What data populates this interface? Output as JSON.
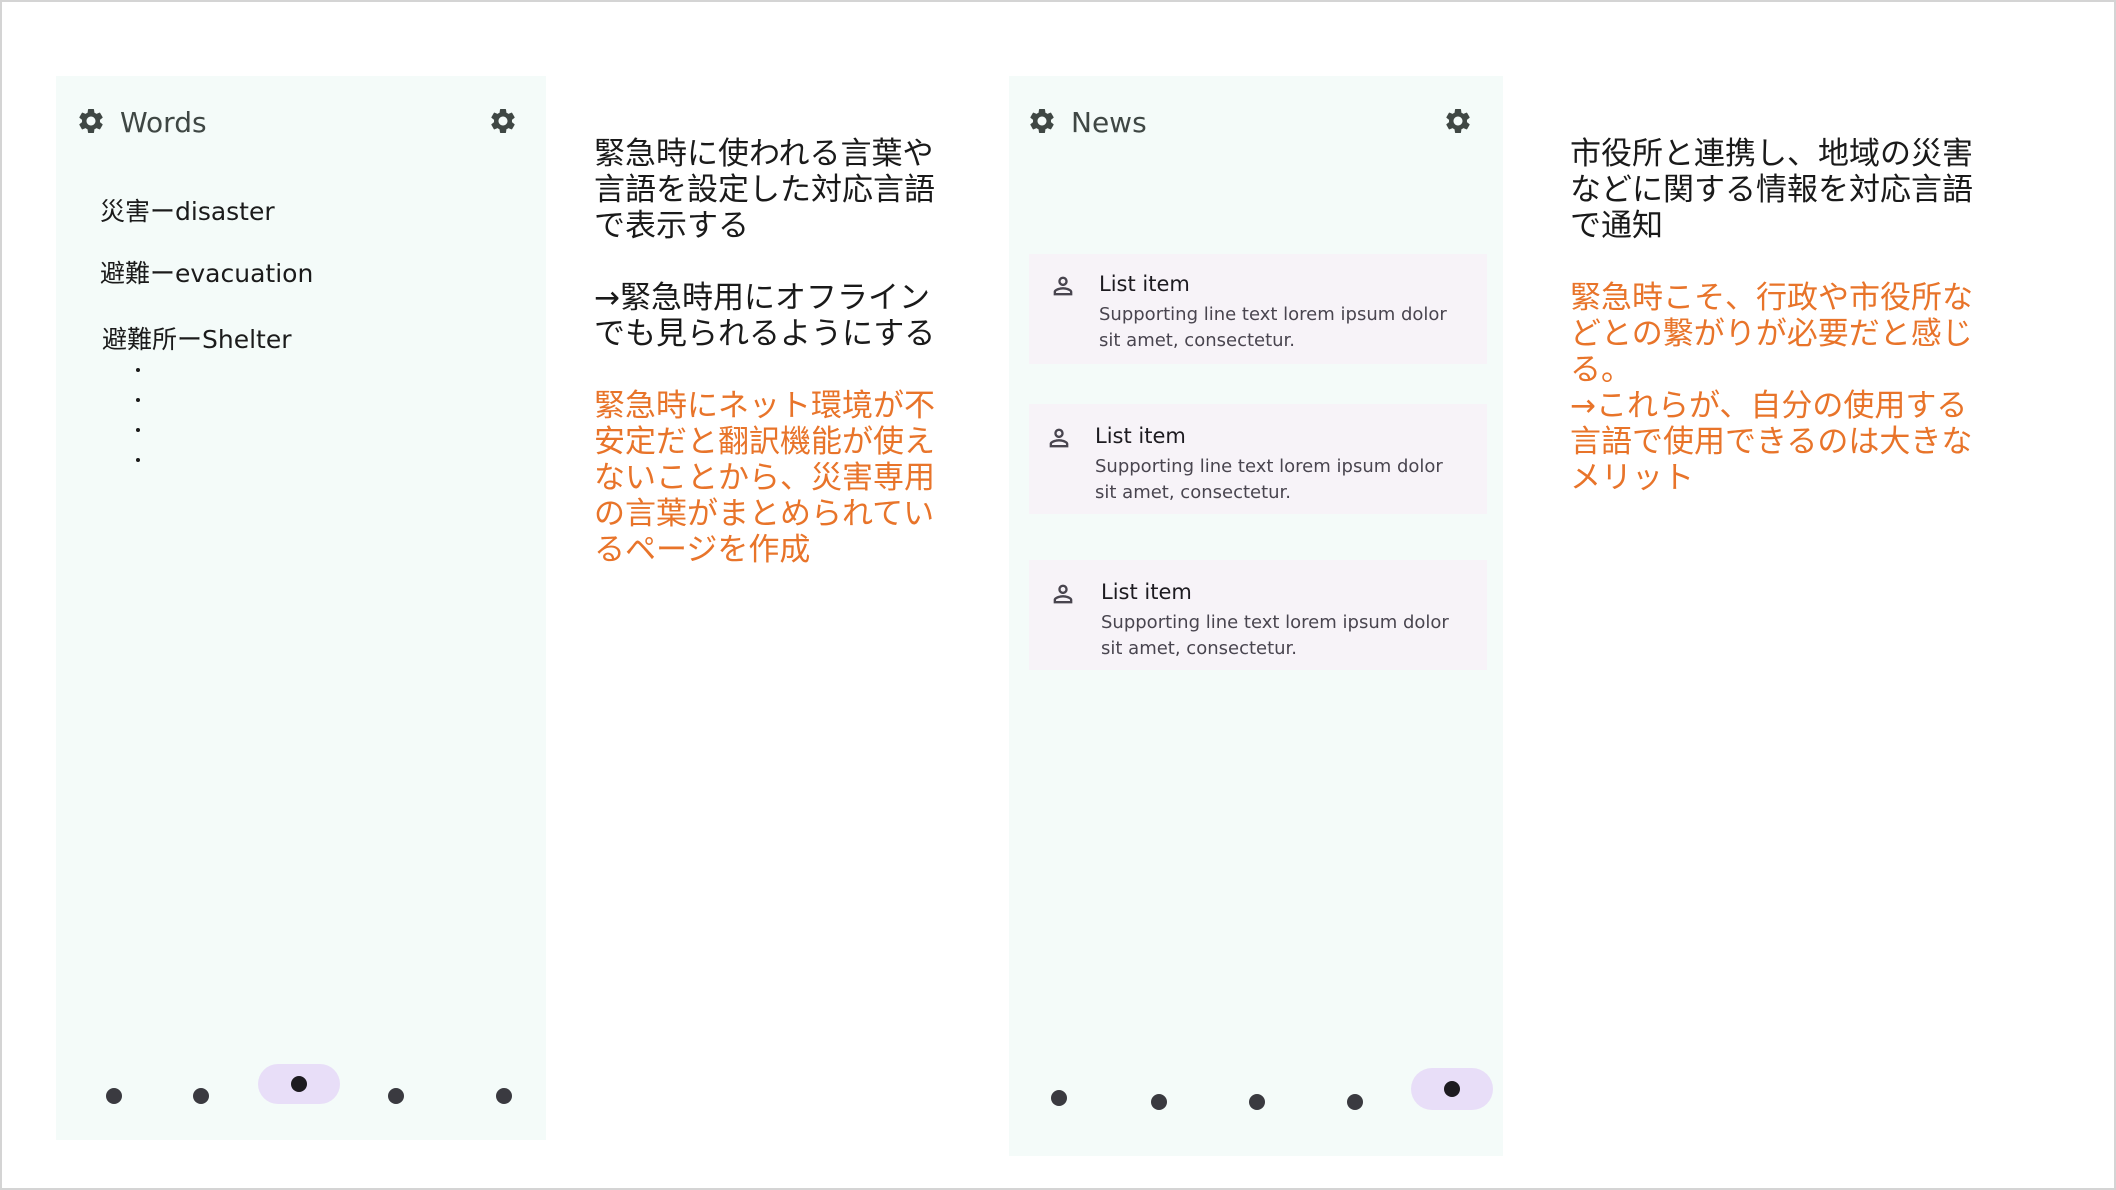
{
  "words_screen": {
    "title": "Words",
    "left_icon": "gear-icon",
    "right_icon": "gear-icon",
    "items": [
      "災害ーdisaster",
      "避難ーevacuation",
      "避難所ーShelter"
    ],
    "bullets": [
      "・",
      "・",
      "・",
      "・"
    ],
    "nav": {
      "count": 5,
      "active_index": 2
    }
  },
  "words_notes": {
    "black_1": "緊急時に使われる言葉や\n言語を設定した対応言語\nで表示する",
    "black_2": "→緊急時用にオフライン\nでも見られるようにする",
    "orange": "緊急時にネット環境が不\n安定だと翻訳機能が使え\nないことから、災害専用\nの言葉がまとめられてい\nるページを作成"
  },
  "news_screen": {
    "title": "News",
    "left_icon": "gear-icon",
    "right_icon": "gear-icon",
    "items": [
      {
        "icon": "person-icon",
        "title": "List item",
        "supporting": "Supporting line text lorem ipsum dolor sit amet, consectetur."
      },
      {
        "icon": "person-icon",
        "title": "List item",
        "supporting": "Supporting line text lorem ipsum dolor sit amet, consectetur."
      },
      {
        "icon": "person-icon",
        "title": "List item",
        "supporting": "Supporting line text lorem ipsum dolor sit amet, consectetur."
      }
    ],
    "nav": {
      "count": 5,
      "active_index": 4
    }
  },
  "news_notes": {
    "black": "市役所と連携し、地域の災害\nなどに関する情報を対応言語\nで通知",
    "orange": "緊急時こそ、行政や市役所な\nどとの繋がりが必要だと感じ\nる。\n→これらが、自分の使用する\n言語で使用できるのは大きな\nメリット"
  },
  "colors": {
    "screen_bg": "#f4fbf9",
    "accent_orange": "#e8742a",
    "nav_active_pill": "#e8def8",
    "card_bg": "#f7f3f8"
  }
}
